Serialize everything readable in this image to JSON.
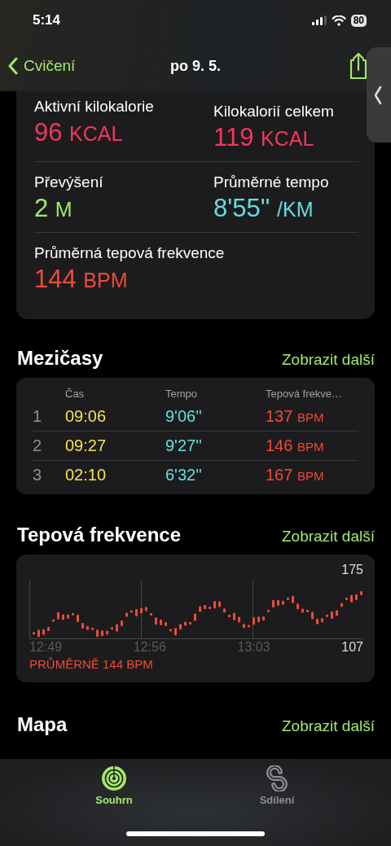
{
  "status_bar": {
    "time": "5:14",
    "battery": "80"
  },
  "nav": {
    "back": "Cvičení",
    "title": "po 9. 5."
  },
  "metrics": [
    {
      "label": "Aktivní kilokalorie",
      "value": "96",
      "unit": "KCAL",
      "color": "#f5365c"
    },
    {
      "label": "Kilokalorií celkem",
      "value": "119",
      "unit": "KCAL",
      "color": "#f5365c"
    },
    {
      "label": "Převýšení",
      "value": "2",
      "unit": "M",
      "color": "#a3e869"
    },
    {
      "label": "Průměrné tempo",
      "value": "8'55''",
      "unit": "/KM",
      "color": "#63dfe0"
    },
    {
      "label": "Průměrná tepová frekvence",
      "value": "144",
      "unit": "BPM",
      "color": "#f04a36"
    }
  ],
  "splits": {
    "title": "Mezičasy",
    "more": "Zobrazit další",
    "columns": [
      "Čas",
      "Tempo",
      "Tepová frekve…"
    ],
    "rows": [
      {
        "number": "1",
        "time": "09:06",
        "pace": "9'06''",
        "heart_rate": "137",
        "unit": "BPM"
      },
      {
        "number": "2",
        "time": "09:27",
        "pace": "9'27''",
        "heart_rate": "146",
        "unit": "BPM"
      },
      {
        "number": "3",
        "time": "02:10",
        "pace": "6'32''",
        "heart_rate": "167",
        "unit": "BPM"
      }
    ]
  },
  "heart_rate": {
    "title": "Tepová frekvence",
    "more": "Zobrazit další",
    "max_label": "175",
    "min_label": "107",
    "time_labels": [
      "12:49",
      "12:56",
      "13:03"
    ],
    "average": "PRŮMĚRNĚ 144 BPM"
  },
  "map": {
    "title": "Mapa",
    "more": "Zobrazit další"
  },
  "tabs": [
    {
      "label": "Souhrn",
      "kind": "summary",
      "selected": true
    },
    {
      "label": "Sdílení",
      "kind": "sharing",
      "selected": false
    }
  ]
}
